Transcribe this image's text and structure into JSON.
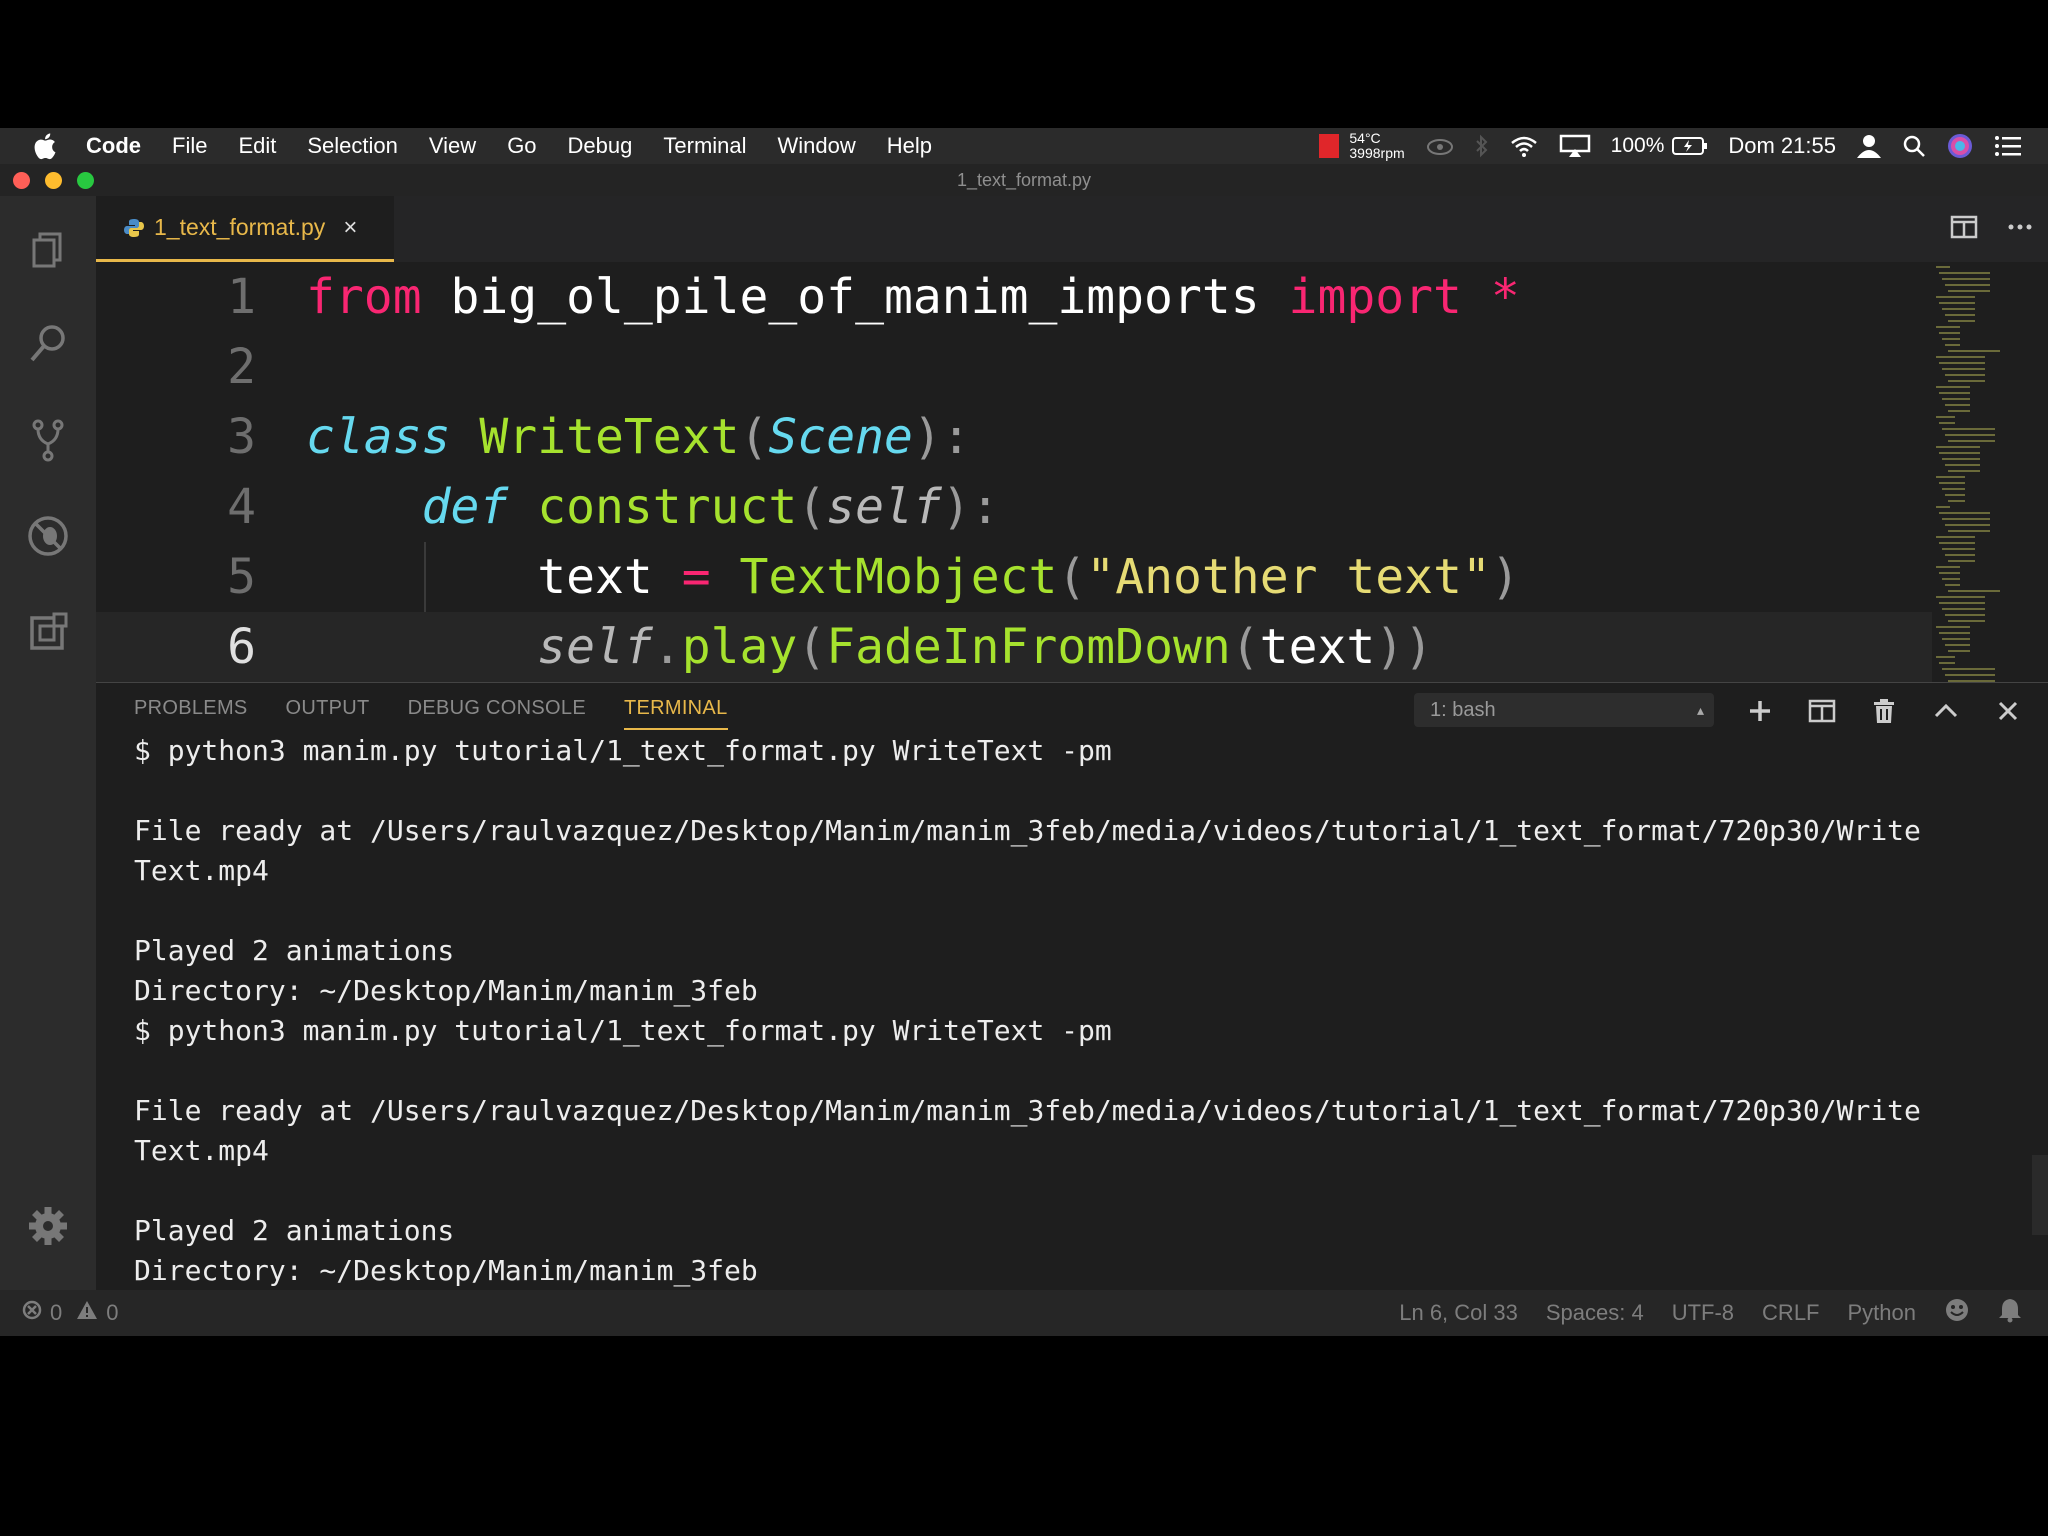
{
  "menubar": {
    "app_name": "Code",
    "items": [
      "File",
      "Edit",
      "Selection",
      "View",
      "Go",
      "Debug",
      "Terminal",
      "Window",
      "Help"
    ],
    "temperature": "54°C",
    "fan": "3998rpm",
    "battery": "100%",
    "clock": "Dom 21:55"
  },
  "window": {
    "title": "1_text_format.py"
  },
  "activity_bar": {
    "icons": [
      "explorer-icon",
      "search-icon",
      "source-control-icon",
      "debug-icon",
      "extensions-icon",
      "gear-icon"
    ]
  },
  "editor": {
    "tab_label": "1_text_format.py",
    "tab_close": "×",
    "lines": [
      {
        "num": "1",
        "tokens": [
          [
            "kw",
            "from"
          ],
          [
            "ws",
            " big_ol_pile_of_manim_imports "
          ],
          [
            "kw",
            "import"
          ],
          [
            "ws",
            " "
          ],
          [
            "op",
            "*"
          ]
        ]
      },
      {
        "num": "2",
        "tokens": []
      },
      {
        "num": "3",
        "tokens": [
          [
            "cls",
            "class"
          ],
          [
            "ws",
            " "
          ],
          [
            "fn",
            "WriteText"
          ],
          [
            "punc",
            "("
          ],
          [
            "cls",
            "Scene"
          ],
          [
            "punc",
            "):"
          ]
        ]
      },
      {
        "num": "4",
        "tokens": [
          [
            "ws",
            "    "
          ],
          [
            "cls",
            "def"
          ],
          [
            "ws",
            " "
          ],
          [
            "fn",
            "construct"
          ],
          [
            "punc",
            "("
          ],
          [
            "self",
            "self"
          ],
          [
            "punc",
            "):"
          ]
        ]
      },
      {
        "num": "5",
        "tokens": [
          [
            "ws",
            "        text "
          ],
          [
            "op",
            "="
          ],
          [
            "ws",
            " "
          ],
          [
            "fn",
            "TextMobject"
          ],
          [
            "punc",
            "("
          ],
          [
            "str",
            "\"Another text\""
          ],
          [
            "punc",
            ")"
          ]
        ]
      },
      {
        "num": "6",
        "tokens": [
          [
            "ws",
            "        "
          ],
          [
            "self",
            "self"
          ],
          [
            "punc",
            "."
          ],
          [
            "fn",
            "play"
          ],
          [
            "punc",
            "("
          ],
          [
            "fn",
            "FadeInFromDown"
          ],
          [
            "punc",
            "("
          ],
          [
            "ws",
            "text"
          ],
          [
            "punc",
            "))"
          ]
        ]
      }
    ],
    "current_line": 6
  },
  "panel": {
    "tabs": [
      "PROBLEMS",
      "OUTPUT",
      "DEBUG CONSOLE",
      "TERMINAL"
    ],
    "active_tab": "TERMINAL",
    "terminal_select": "1: bash",
    "terminal_lines": [
      "$ python3 manim.py tutorial/1_text_format.py WriteText -pm",
      "",
      "File ready at /Users/raulvazquez/Desktop/Manim/manim_3feb/media/videos/tutorial/1_text_format/720p30/Write",
      "Text.mp4",
      "",
      "Played 2 animations",
      "Directory: ~/Desktop/Manim/manim_3feb",
      "$ python3 manim.py tutorial/1_text_format.py WriteText -pm",
      "",
      "File ready at /Users/raulvazquez/Desktop/Manim/manim_3feb/media/videos/tutorial/1_text_format/720p30/Write",
      "Text.mp4",
      "",
      "Played 2 animations",
      "Directory: ~/Desktop/Manim/manim_3feb"
    ],
    "prompt": "$"
  },
  "statusbar": {
    "errors": "0",
    "warnings": "0",
    "position": "Ln 6, Col 33",
    "spaces": "Spaces: 4",
    "encoding": "UTF-8",
    "eol": "CRLF",
    "language": "Python"
  }
}
